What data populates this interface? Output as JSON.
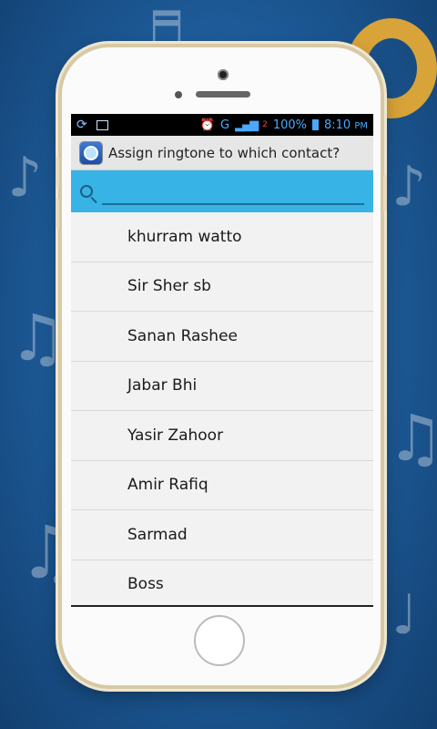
{
  "status_bar": {
    "battery_percent": "100%",
    "time": "8:10",
    "time_suffix": "PM",
    "network": "G",
    "sim_slot": "2"
  },
  "title_bar": {
    "title": "Assign ringtone to which contact?"
  },
  "search": {
    "placeholder": "",
    "value": ""
  },
  "contacts": [
    "khurram watto",
    "Sir Sher sb",
    "Sanan Rashee",
    "Jabar Bhi",
    "Yasir Zahoor",
    "Amir Rafiq",
    "Sarmad",
    "Boss"
  ],
  "colors": {
    "search_bar": "#38b3e6",
    "title_bar": "#e6e6e6",
    "status_bar": "#000000",
    "phone_body": "#fbfbfb"
  }
}
